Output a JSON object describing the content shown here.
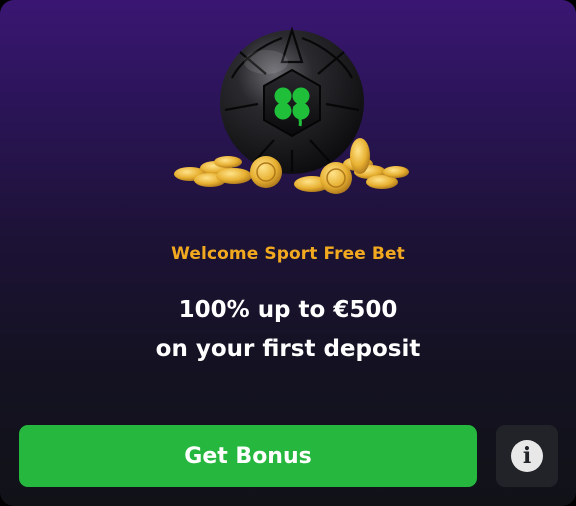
{
  "promo": {
    "title": "Welcome Sport Free Bet",
    "offer_line1": "100% up to €500",
    "offer_line2": "on your first deposit"
  },
  "actions": {
    "get_bonus_label": "Get Bonus",
    "info_icon_glyph": "i"
  },
  "colors": {
    "accent_title": "#f2a91f",
    "cta_green": "#25b73e",
    "background_top": "#3a1673",
    "background_bottom": "#111218"
  },
  "icons": {
    "hero": "soccer-ball-with-clover-and-coins",
    "info": "info-icon"
  }
}
